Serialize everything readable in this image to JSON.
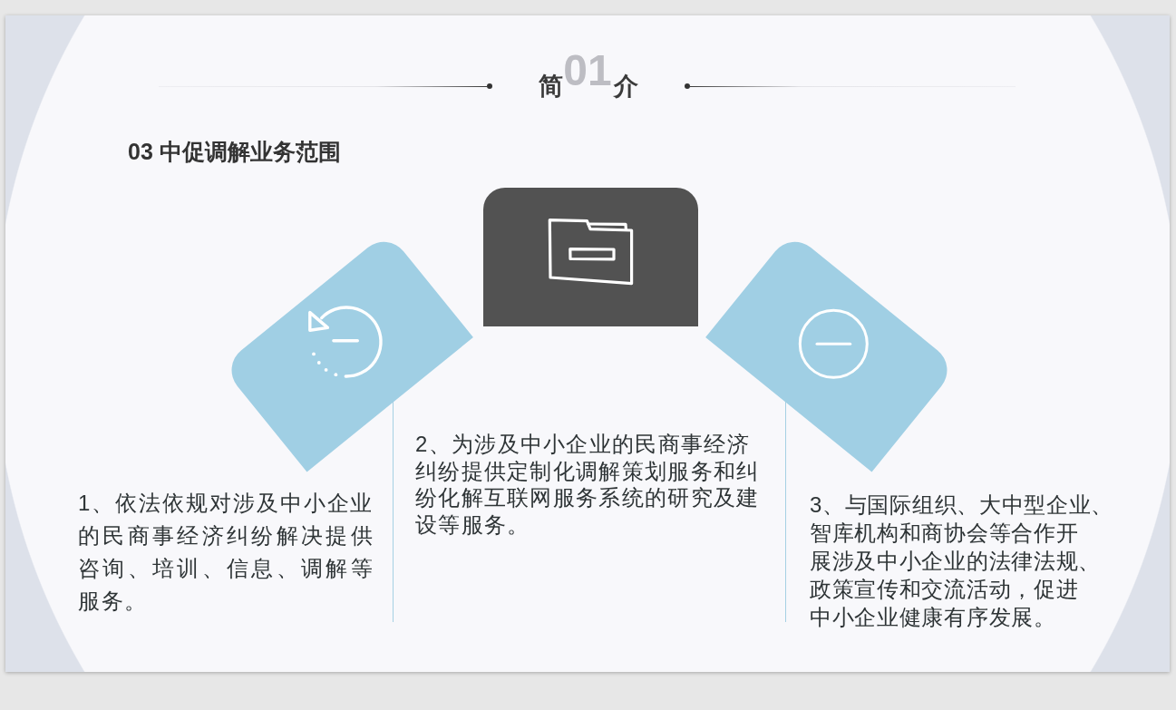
{
  "slide": {
    "section_number": "01",
    "title": [
      "简",
      "介"
    ],
    "heading": "03 中促调解业务范围",
    "items": [
      {
        "kind": "rotate",
        "lines": [
          "1、依法依规对涉及中小企业",
          "的民商事经济纠纷解决提供",
          "咨询、培训、信息、调解等",
          "服务。"
        ]
      },
      {
        "kind": "folder",
        "lines": [
          "2、为涉及中小企业的民商事经济",
          "纠纷提供定制化调解策划服务和纠",
          "纷化解互联网服务系统的研究及建",
          "设等服务。"
        ]
      },
      {
        "kind": "minus",
        "lines": [
          "3、与国际组织、大中型企业、",
          "智库机构和商协会等合作开",
          "展涉及中小企业的法律法规、",
          "政策宣传和交流活动，促进",
          "中小企业健康有序发展。"
        ]
      }
    ]
  }
}
